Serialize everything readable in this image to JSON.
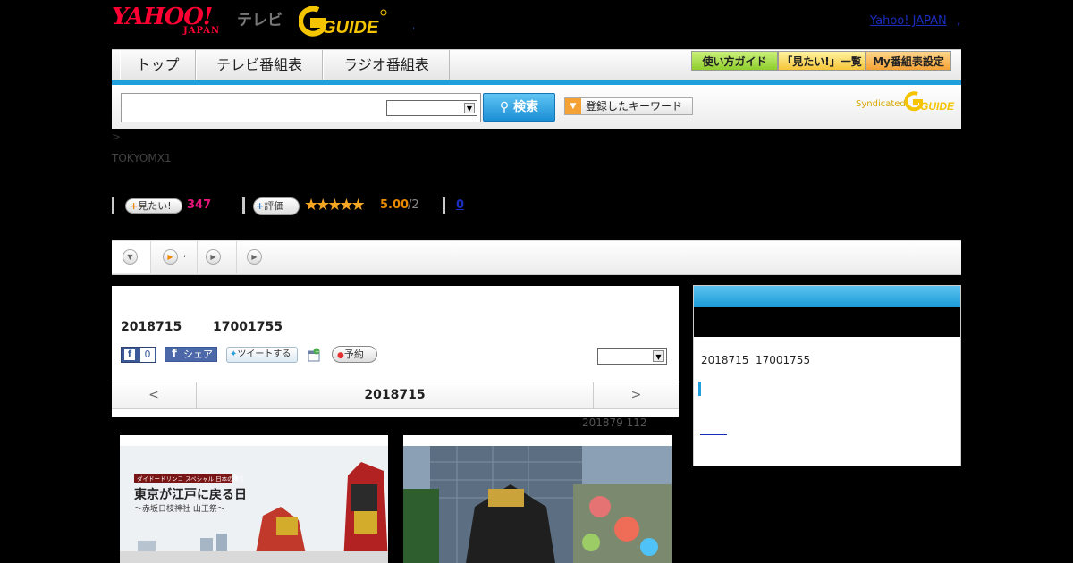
{
  "header": {
    "yahoo_logo_main": "YAHOO!",
    "yahoo_logo_sub": "JAPAN",
    "tv_label": "テレビ",
    "gguide_logo": "GUIDE",
    "dot_link": ",",
    "yahoo_japan_link": "Yahoo! JAPAN",
    "trailing_link": ","
  },
  "nav": {
    "tabs": [
      {
        "label": "トップ"
      },
      {
        "label": "テレビ番組表"
      },
      {
        "label": "ラジオ番組表"
      }
    ],
    "right_buttons": [
      {
        "label": "使い方ガイド"
      },
      {
        "label": "「見たい!」一覧"
      },
      {
        "label": "My番組表設定"
      }
    ]
  },
  "search": {
    "input_value": "",
    "select_value": "",
    "button_label": "検索",
    "keyword_button_label": "登録したキーワード",
    "syndicated_label": "Syndicated",
    "syndicated_logo": "GUIDE"
  },
  "program": {
    "breadcrumb": ">",
    "channel": "TOKYOMX1",
    "mitai_button": "見たい!",
    "mitai_count": "347",
    "hyoka_button": "評価",
    "stars": "★★★★★",
    "score": "5.00",
    "score_count": "/2",
    "comment_count": "0"
  },
  "tabs": {
    "second_tab_dot": ","
  },
  "main": {
    "date": "2018715",
    "time": "17001755",
    "fb_like_count": "0",
    "fb_share_label": "シェア",
    "tweet_label": "ツイートする",
    "yoyaku_label": "予約",
    "select_value": "",
    "prev_label": "<",
    "center_date": "2018715",
    "next_label": ">",
    "update_note": "201879  112"
  },
  "images": {
    "thumb1_small_caption": "ダイドードリンコ スペシャル 日本の祭り",
    "thumb1_title": "東京が江戸に戻る日",
    "thumb1_subtitle": "～赤坂日枝神社 山王祭～"
  },
  "side": {
    "date": "2018715",
    "time": "17001755"
  },
  "colors": {
    "accent_blue": "#1fa0dc",
    "yahoo_red": "#ff0033",
    "gguide_yellow": "#f5c400",
    "mitai_pink": "#e5157a",
    "score_orange": "#e88a00"
  }
}
